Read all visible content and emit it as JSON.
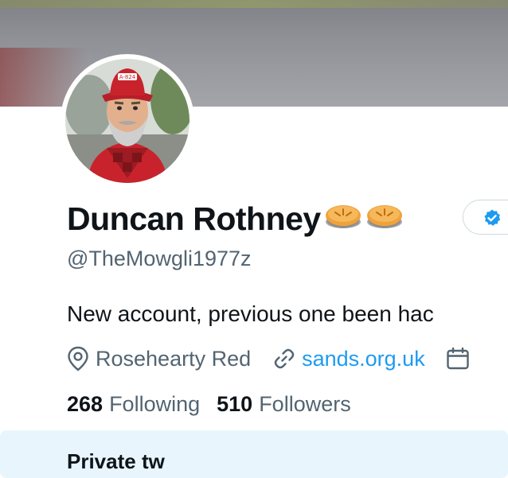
{
  "profile": {
    "display_name": "Duncan Rothney",
    "name_emojis": [
      "pie-emoji",
      "pie-emoji"
    ],
    "handle": "@TheMowgli1977z",
    "bio": "New account, previous one been hac",
    "location": "Rosehearty Red",
    "website": "sands.org.uk",
    "following_count": "268",
    "following_label": "Following",
    "followers_count": "510",
    "followers_label": "Followers",
    "verified_badge": "verified-badge-icon"
  },
  "notice": {
    "text": "Private tw"
  },
  "colors": {
    "text_primary": "#0f1419",
    "text_secondary": "#536471",
    "link": "#1d9bf0",
    "notice_bg": "#e8f5fd"
  }
}
